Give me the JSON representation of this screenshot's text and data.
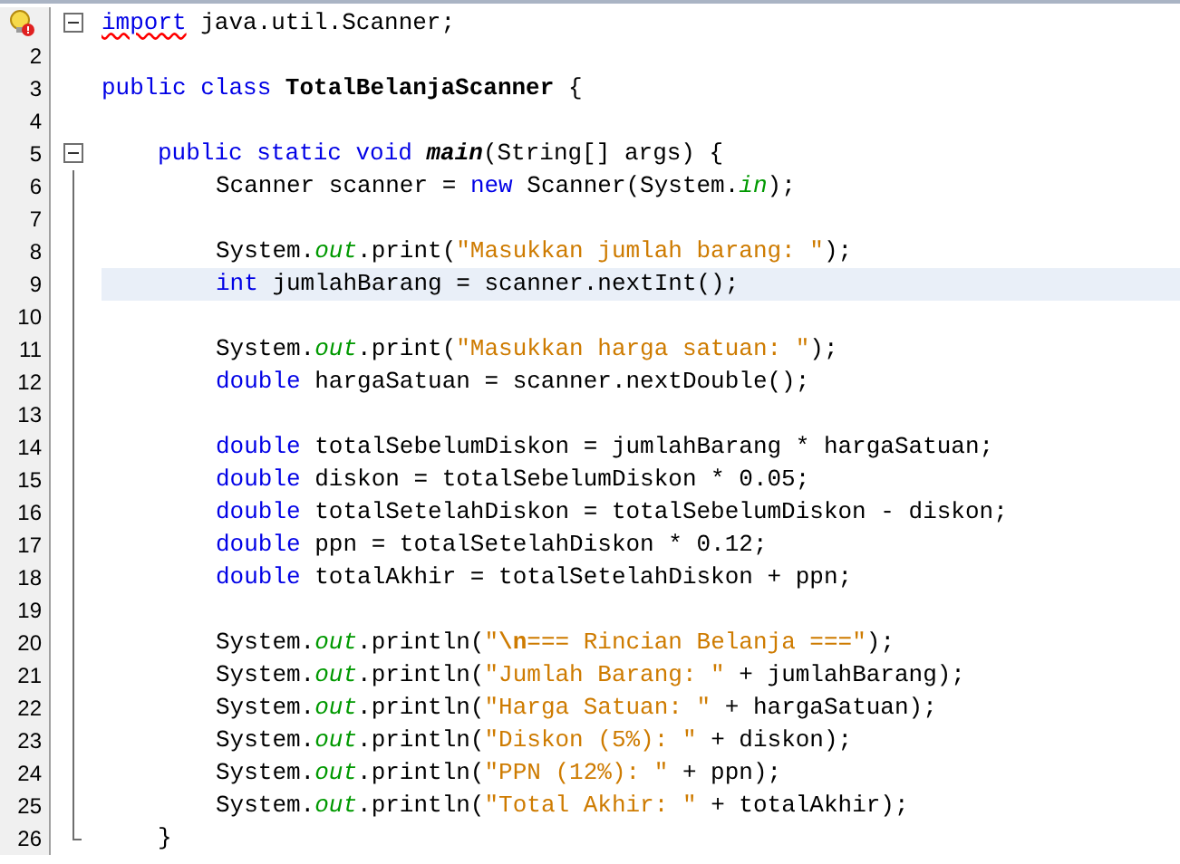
{
  "lines": [
    {
      "hint": true,
      "foldable": true,
      "current": false,
      "tokens": [
        {
          "text": "import",
          "kind": "keyword_flagged"
        },
        {
          "text": " java.util.Scanner;",
          "kind": "plain"
        }
      ]
    },
    {
      "number": "2",
      "hint": false,
      "foldable": false,
      "current": false
    },
    {
      "number": "3",
      "hint": false,
      "foldable": false,
      "current": false,
      "tokens": [
        {
          "text": "public class ",
          "kind": "keyword"
        },
        {
          "text": "TotalBelanjaScanner",
          "kind": "class"
        },
        {
          "text": " {",
          "kind": "plain"
        }
      ],
      "children": [
        {
          "number": "4",
          "hint": false,
          "foldable": false,
          "current": false
        },
        {
          "number": "5",
          "hint": false,
          "foldable": true,
          "current": false,
          "tokens": [
            {
              "text": "public static void ",
              "kind": "keyword"
            },
            {
              "text": "main",
              "kind": "method"
            },
            {
              "text": "(String[] args) {",
              "kind": "plain"
            }
          ],
          "children": [
            {
              "number": "6",
              "hint": false,
              "foldable": false,
              "current": false,
              "tokens": [
                {
                  "text": "Scanner scanner = ",
                  "kind": "plain"
                },
                {
                  "text": "new",
                  "kind": "keyword"
                },
                {
                  "text": " Scanner(System.",
                  "kind": "plain"
                },
                {
                  "text": "in",
                  "kind": "field"
                },
                {
                  "text": ");",
                  "kind": "plain"
                }
              ]
            },
            {
              "number": "7",
              "hint": false,
              "foldable": false,
              "current": false
            },
            {
              "number": "8",
              "hint": false,
              "foldable": false,
              "current": false,
              "tokens": [
                {
                  "text": "System.",
                  "kind": "plain"
                },
                {
                  "text": "out",
                  "kind": "field"
                },
                {
                  "text": ".print(",
                  "kind": "plain"
                },
                {
                  "text": "\"Masukkan jumlah barang: \"",
                  "kind": "string"
                },
                {
                  "text": ");",
                  "kind": "plain"
                }
              ]
            },
            {
              "number": "9",
              "hint": false,
              "foldable": false,
              "current": true,
              "tokens": [
                {
                  "text": "int",
                  "kind": "keyword"
                },
                {
                  "text": " jumlahBarang = scanner.nextInt();",
                  "kind": "plain"
                }
              ]
            },
            {
              "number": "10",
              "hint": false,
              "foldable": false,
              "current": false
            },
            {
              "number": "11",
              "hint": false,
              "foldable": false,
              "current": false,
              "tokens": [
                {
                  "text": "System.",
                  "kind": "plain"
                },
                {
                  "text": "out",
                  "kind": "field"
                },
                {
                  "text": ".print(",
                  "kind": "plain"
                },
                {
                  "text": "\"Masukkan harga satuan: \"",
                  "kind": "string"
                },
                {
                  "text": ");",
                  "kind": "plain"
                }
              ]
            },
            {
              "number": "12",
              "hint": false,
              "foldable": false,
              "current": false,
              "tokens": [
                {
                  "text": "double",
                  "kind": "keyword"
                },
                {
                  "text": " hargaSatuan = scanner.nextDouble();",
                  "kind": "plain"
                }
              ]
            },
            {
              "number": "13",
              "hint": false,
              "foldable": false,
              "current": false
            },
            {
              "number": "14",
              "hint": false,
              "foldable": false,
              "current": false,
              "tokens": [
                {
                  "text": "double",
                  "kind": "keyword"
                },
                {
                  "text": " totalSebelumDiskon = jumlahBarang * hargaSatuan;",
                  "kind": "plain"
                }
              ]
            },
            {
              "number": "15",
              "hint": false,
              "foldable": false,
              "current": false,
              "tokens": [
                {
                  "text": "double",
                  "kind": "keyword"
                },
                {
                  "text": " diskon = totalSebelumDiskon * 0.05;",
                  "kind": "plain"
                }
              ]
            },
            {
              "number": "16",
              "hint": false,
              "foldable": false,
              "current": false,
              "tokens": [
                {
                  "text": "double",
                  "kind": "keyword"
                },
                {
                  "text": " totalSetelahDiskon = totalSebelumDiskon - diskon;",
                  "kind": "plain"
                }
              ]
            },
            {
              "number": "17",
              "hint": false,
              "foldable": false,
              "current": false,
              "tokens": [
                {
                  "text": "double",
                  "kind": "keyword"
                },
                {
                  "text": " ppn = totalSetelahDiskon * 0.12;",
                  "kind": "plain"
                }
              ]
            },
            {
              "number": "18",
              "hint": false,
              "foldable": false,
              "current": false,
              "tokens": [
                {
                  "text": "double",
                  "kind": "keyword"
                },
                {
                  "text": " totalAkhir = totalSetelahDiskon + ppn;",
                  "kind": "plain"
                }
              ]
            },
            {
              "number": "19",
              "hint": false,
              "foldable": false,
              "current": false
            },
            {
              "number": "20",
              "hint": false,
              "foldable": false,
              "current": false,
              "tokens": [
                {
                  "text": "System.",
                  "kind": "plain"
                },
                {
                  "text": "out",
                  "kind": "field"
                },
                {
                  "text": ".println(",
                  "kind": "plain"
                },
                {
                  "text": "\"",
                  "kind": "string"
                },
                {
                  "text": "\\n",
                  "kind": "escape"
                },
                {
                  "text": "=== Rincian Belanja ===\"",
                  "kind": "string"
                },
                {
                  "text": ");",
                  "kind": "plain"
                }
              ]
            },
            {
              "number": "21",
              "hint": false,
              "foldable": false,
              "current": false,
              "tokens": [
                {
                  "text": "System.",
                  "kind": "plain"
                },
                {
                  "text": "out",
                  "kind": "field"
                },
                {
                  "text": ".println(",
                  "kind": "plain"
                },
                {
                  "text": "\"Jumlah Barang: \"",
                  "kind": "string"
                },
                {
                  "text": " + jumlahBarang);",
                  "kind": "plain"
                }
              ]
            },
            {
              "number": "22",
              "hint": false,
              "foldable": false,
              "current": false,
              "tokens": [
                {
                  "text": "System.",
                  "kind": "plain"
                },
                {
                  "text": "out",
                  "kind": "field"
                },
                {
                  "text": ".println(",
                  "kind": "plain"
                },
                {
                  "text": "\"Harga Satuan: \"",
                  "kind": "string"
                },
                {
                  "text": " + hargaSatuan);",
                  "kind": "plain"
                }
              ]
            },
            {
              "number": "23",
              "hint": false,
              "foldable": false,
              "current": false,
              "tokens": [
                {
                  "text": "System.",
                  "kind": "plain"
                },
                {
                  "text": "out",
                  "kind": "field"
                },
                {
                  "text": ".println(",
                  "kind": "plain"
                },
                {
                  "text": "\"Diskon (5%): \"",
                  "kind": "string"
                },
                {
                  "text": " + diskon);",
                  "kind": "plain"
                }
              ]
            },
            {
              "number": "24",
              "hint": false,
              "foldable": false,
              "current": false,
              "tokens": [
                {
                  "text": "System.",
                  "kind": "plain"
                },
                {
                  "text": "out",
                  "kind": "field"
                },
                {
                  "text": ".println(",
                  "kind": "plain"
                },
                {
                  "text": "\"PPN (12%): \"",
                  "kind": "string"
                },
                {
                  "text": " + ppn);",
                  "kind": "plain"
                }
              ]
            },
            {
              "number": "25",
              "hint": false,
              "foldable": false,
              "current": false,
              "tokens": [
                {
                  "text": "System.",
                  "kind": "plain"
                },
                {
                  "text": "out",
                  "kind": "field"
                },
                {
                  "text": ".println(",
                  "kind": "plain"
                },
                {
                  "text": "\"Total Akhir: \"",
                  "kind": "string"
                },
                {
                  "text": " + totalAkhir);",
                  "kind": "plain"
                }
              ]
            }
          ],
          "closing": {
            "number": "26",
            "hint": false,
            "foldable": false,
            "current": false,
            "tokens": [
              {
                "text": "}",
                "kind": "plain"
              }
            ]
          }
        }
      ]
    }
  ]
}
